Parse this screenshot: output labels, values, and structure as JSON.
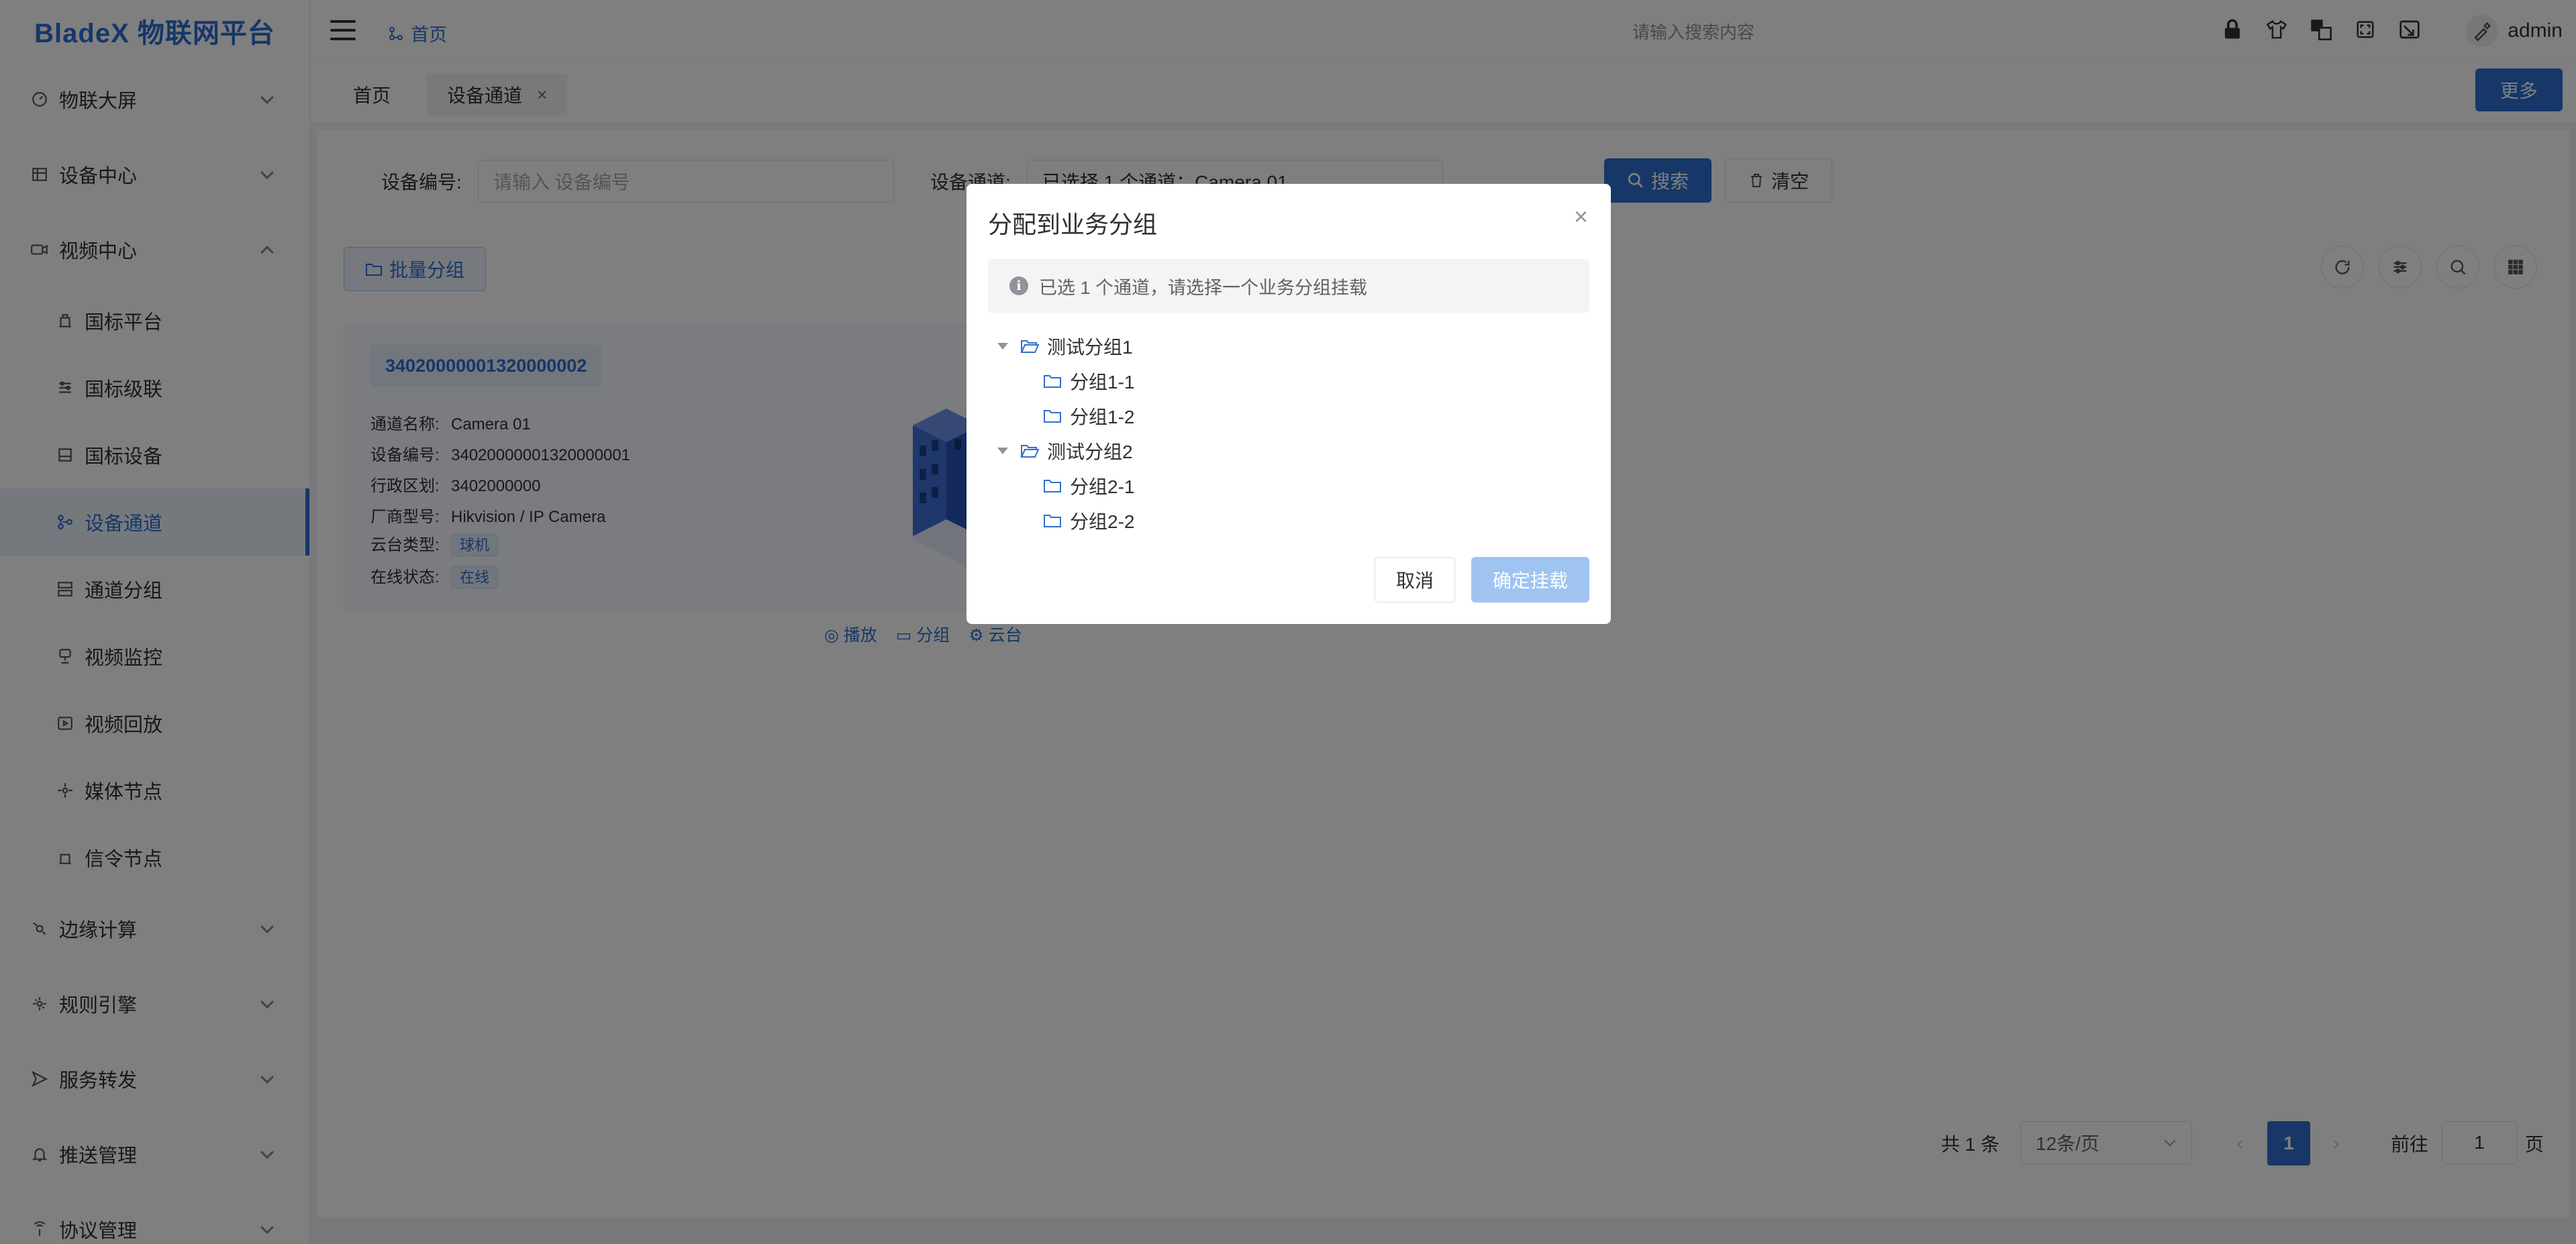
{
  "app": {
    "logo": "BladeX 物联网平台"
  },
  "sidebar": {
    "items": [
      {
        "label": "物联大屏",
        "icon": "dashboard-icon"
      },
      {
        "label": "设备中心",
        "icon": "device-icon"
      },
      {
        "label": "视频中心",
        "icon": "video-icon"
      },
      {
        "label": "国标平台",
        "icon": "platform-icon"
      },
      {
        "label": "国标级联",
        "icon": "cascade-icon"
      },
      {
        "label": "国标设备",
        "icon": "gb-device-icon"
      },
      {
        "label": "设备通道",
        "icon": "channel-icon"
      },
      {
        "label": "通道分组",
        "icon": "group-icon"
      },
      {
        "label": "视频监控",
        "icon": "monitor-icon"
      },
      {
        "label": "视频回放",
        "icon": "playback-icon"
      },
      {
        "label": "媒体节点",
        "icon": "media-node-icon"
      },
      {
        "label": "信令节点",
        "icon": "signal-node-icon"
      },
      {
        "label": "边缘计算",
        "icon": "edge-icon"
      },
      {
        "label": "规则引擎",
        "icon": "rule-icon"
      },
      {
        "label": "服务转发",
        "icon": "forward-icon"
      },
      {
        "label": "推送管理",
        "icon": "bell-icon"
      },
      {
        "label": "协议管理",
        "icon": "protocol-icon"
      }
    ]
  },
  "topbar": {
    "breadcrumb": "首页",
    "search_placeholder": "请输入搜索内容",
    "user": "admin"
  },
  "tabs": {
    "home": "首页",
    "current": "设备通道",
    "close": "×",
    "more": "更多"
  },
  "filters": {
    "device_no_label": "设备编号:",
    "device_no_placeholder": "请输入 设备编号",
    "channel_label": "设备通道:",
    "channel_value": "已选择 1 个通道：Camera 01",
    "search": "搜索",
    "clear": "清空",
    "batch_group": "批量分组"
  },
  "card": {
    "tag": "34020000001320000002",
    "rows": [
      {
        "k": "通道名称:",
        "v": "Camera 01"
      },
      {
        "k": "设备编号:",
        "v": "34020000001320000001"
      },
      {
        "k": "行政区划:",
        "v": "3402000000"
      },
      {
        "k": "厂商型号:",
        "v": "Hikvision / IP Camera"
      }
    ],
    "ptz_label": "云台类型:",
    "ptz_value": "球机",
    "status_label": "在线状态:",
    "status_value": "在线",
    "actions": {
      "play": "播放",
      "group": "分组",
      "ptz": "云台"
    }
  },
  "pagination": {
    "total": "共 1 条",
    "size": "12条/页",
    "page": "1",
    "goto": "前往",
    "goto_value": "1",
    "page_unit": "页"
  },
  "dialog": {
    "title": "分配到业务分组",
    "close": "×",
    "info": "已选 1 个通道，请选择一个业务分组挂载",
    "tree": [
      {
        "label": "测试分组1",
        "children": [
          "分组1-1",
          "分组1-2"
        ]
      },
      {
        "label": "测试分组2",
        "children": [
          "分组2-1",
          "分组2-2"
        ]
      }
    ],
    "cancel": "取消",
    "confirm": "确定挂载"
  },
  "colors": {
    "primary": "#2d6fd1",
    "confirm_disabled": "#a0c4f2"
  }
}
